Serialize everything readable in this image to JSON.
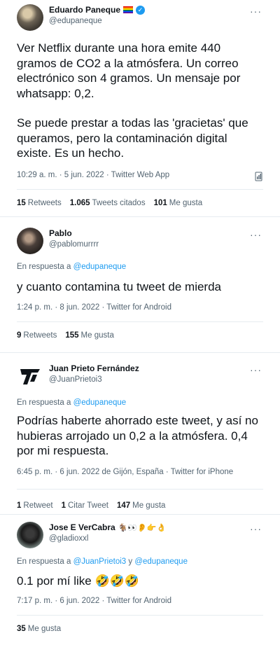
{
  "tweet1": {
    "author": "Eduardo Paneque",
    "handle": "@edupaneque",
    "body_1": "Ver Netflix durante una hora emite 440 gramos de CO2 a la atmósfera. Un correo electrónico son 4 gramos. Un mensaje por whatsapp: 0,2.",
    "body_2": "Se puede prestar a todas las 'gracietas' que queramos, pero la contaminación digital existe. Es un hecho.",
    "meta": "10:29 a. m. · 5 jun. 2022 · Twitter Web App",
    "retweets_count": "15",
    "retweets_label": "Retweets",
    "quotes_count": "1.065",
    "quotes_label": "Tweets citados",
    "likes_count": "101",
    "likes_label": "Me gusta"
  },
  "tweet2": {
    "author": "Pablo",
    "handle": "@pablomurrrr",
    "reply_prefix": "En respuesta a",
    "reply_to": "@edupaneque",
    "body": "y cuanto contamina tu tweet de mierda",
    "meta": "1:24 p. m. · 8 jun. 2022 · Twitter for Android",
    "retweets_count": "9",
    "retweets_label": "Retweets",
    "likes_count": "155",
    "likes_label": "Me gusta"
  },
  "tweet3": {
    "author": "Juan Prieto Fernández",
    "handle": "@JuanPrietoi3",
    "reply_prefix": "En respuesta a",
    "reply_to": "@edupaneque",
    "body": "Podrías haberte ahorrado este tweet, y así no hubieras arrojado un 0,2 a la atmósfera. 0,4 por mi respuesta.",
    "meta": "6:45 p. m. · 6 jun. 2022 de Gijón, España · Twitter for iPhone",
    "retweets_count": "1",
    "retweets_label": "Retweet",
    "quotes_count": "1",
    "quotes_label": "Citar Tweet",
    "likes_count": "147",
    "likes_label": "Me gusta"
  },
  "tweet4": {
    "author": "Jose E VerCabra",
    "author_emoji": "🐐👀👂👉👌",
    "handle": "@gladioxxl",
    "reply_prefix": "En respuesta a",
    "reply_to_1": "@JuanPrietoi3",
    "reply_join": "y",
    "reply_to_2": "@edupaneque",
    "body_text": "0.1 por mí like",
    "body_emoji": "🤣🤣🤣",
    "meta": "7:17 p. m. · 6 jun. 2022 · Twitter for Android",
    "likes_count": "35",
    "likes_label": "Me gusta"
  },
  "icons": {
    "more": "more-icon",
    "verified": "verified-icon",
    "analytics": "analytics-icon",
    "flag": "pride-flag-icon"
  },
  "colors": {
    "accent": "#1d9bf0",
    "text": "#0f1419",
    "muted": "#536471",
    "divider": "#e6ecf0"
  }
}
